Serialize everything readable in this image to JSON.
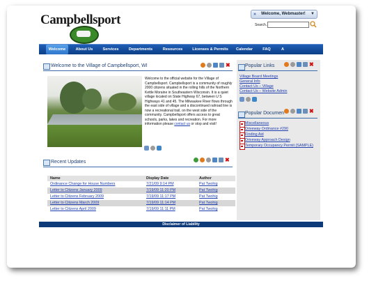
{
  "site": {
    "logo_text": "Campbellsport",
    "welcome_label": "Welcome, Webmaster!",
    "search_label": "Search..."
  },
  "nav": {
    "items": [
      {
        "label": "Welcome",
        "active": true
      },
      {
        "label": "About Us"
      },
      {
        "label": "Services"
      },
      {
        "label": "Departments"
      },
      {
        "label": "Resources"
      },
      {
        "label": "Licenses & Permits"
      },
      {
        "label": "Calendar"
      },
      {
        "label": "FAQ"
      },
      {
        "label": "A"
      }
    ]
  },
  "welcome_panel": {
    "title": "Welcome to the Village of Campbellsport, WI",
    "text_before_link": "Welcome to the official website for the Village of Campbellsport.  Campbellsport is a community of roughly 2000 citizens situated in the rolling hills of the Northern Kettle Moraine in Southeastern Wisconsin.  It is a quiet village located on State Highway 67, between U S Highways 41 and 45.  The Milwaukee River flows through the east side of village and a discontinued railroad line is now a recreational trail, on the west side of the community.  Campbellsport offers access to great schools, parks, lakes and recreation.  For more information please ",
    "link_text": "contact us",
    "text_after_link": " or stop and visit!"
  },
  "recent_updates": {
    "title": "Recent Updates",
    "columns": [
      "Name",
      "Display Date",
      "Author"
    ],
    "rows": [
      {
        "name": "Ordinance Change for House Numbers",
        "date": "7/21/09 9:14 PM",
        "author": "Pat Twohig"
      },
      {
        "name": "Letter to Citizens January 2009",
        "date": "7/19/09 11:20 PM",
        "author": "Pat Twohig"
      },
      {
        "name": "Letter to Citizens February 2009",
        "date": "7/19/09 11:17 PM",
        "author": "Pat Twohig"
      },
      {
        "name": "Letter to Citizens March 2009",
        "date": "7/19/09 11:14 PM",
        "author": "Pat Twohig"
      },
      {
        "name": "Letter to Citizens April 2009",
        "date": "7/19/09 11:11 PM",
        "author": "Pat Twohig"
      }
    ]
  },
  "popular_links": {
    "title": "Popular Links",
    "items": [
      "Village Board Meetings",
      "General Info",
      "Contact Us – Village",
      "Contact Us – Website Admin"
    ]
  },
  "popular_documents": {
    "title": "Popular Documents",
    "items": [
      "Miscellaneous",
      "Driveway Ordinance #290",
      "Finding Aid",
      "Driveway Approach Design",
      "Temporary Occupancy Permit (SAMPLE)"
    ]
  },
  "footer": {
    "label": "Disclaimer of Liability"
  },
  "colors": {
    "nav_bg": "#0c3e86",
    "nav_active": "#3a86d8",
    "link": "#1f3fb0",
    "footer_bg": "#0f3a7a"
  }
}
